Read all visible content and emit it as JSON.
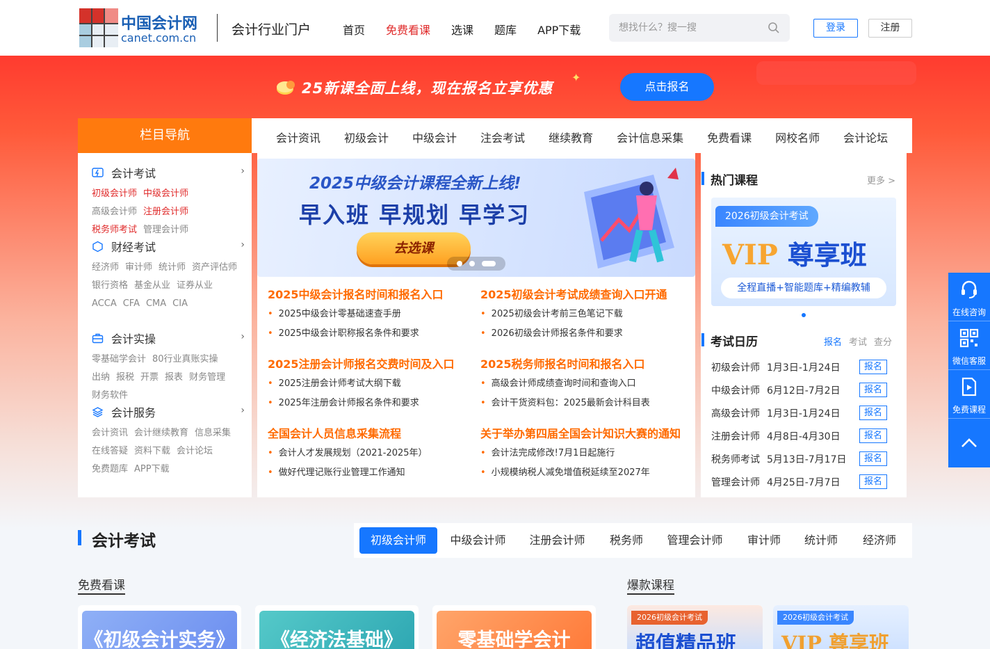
{
  "header": {
    "logo_cn": "中国会计网",
    "logo_en": "canet.com.cn",
    "portal": "会计行业门户",
    "nav": [
      "首页",
      "免费看课",
      "选课",
      "题库",
      "APP下载"
    ],
    "search_placeholder": "想找什么？搜一搜",
    "login": "登录",
    "register": "注册"
  },
  "promo": {
    "text": "25新课全面上线，现在报名立享优惠",
    "button": "点击报名"
  },
  "channel": {
    "title": "栏目导航",
    "items": [
      "会计资讯",
      "初级会计",
      "中级会计",
      "注会考试",
      "继续教育",
      "会计信息采集",
      "免费看课",
      "网校名师",
      "会计论坛"
    ]
  },
  "categories": [
    {
      "title": "会计考试",
      "icon": "lightning-icon",
      "links": [
        {
          "t": "初级会计师",
          "hot": true
        },
        {
          "t": "中级会计师",
          "hot": true
        },
        {
          "t": "高级会计师",
          "hot": false
        },
        {
          "t": "注册会计师",
          "hot": true
        },
        {
          "t": "税务师考试",
          "hot": true
        },
        {
          "t": "管理会计师",
          "hot": false
        }
      ]
    },
    {
      "title": "财经考试",
      "icon": "hexagon-icon",
      "links": [
        {
          "t": "经济师",
          "hot": false
        },
        {
          "t": "审计师",
          "hot": false
        },
        {
          "t": "统计师",
          "hot": false
        },
        {
          "t": "资产评估师",
          "hot": false
        },
        {
          "t": "银行资格",
          "hot": false
        },
        {
          "t": "基金从业",
          "hot": false
        },
        {
          "t": "证券从业",
          "hot": false
        },
        {
          "t": "ACCA",
          "hot": false
        },
        {
          "t": "CFA",
          "hot": false
        },
        {
          "t": "CMA",
          "hot": false
        },
        {
          "t": "CIA",
          "hot": false
        }
      ]
    },
    {
      "title": "会计实操",
      "icon": "briefcase-icon",
      "links": [
        {
          "t": "零基础学会计",
          "hot": false
        },
        {
          "t": "80行业真账实操",
          "hot": false
        },
        {
          "t": "出纳",
          "hot": false
        },
        {
          "t": "报税",
          "hot": false
        },
        {
          "t": "开票",
          "hot": false
        },
        {
          "t": "报表",
          "hot": false
        },
        {
          "t": "财务管理",
          "hot": false
        },
        {
          "t": "财务软件",
          "hot": false
        }
      ]
    },
    {
      "title": "会计服务",
      "icon": "layers-icon",
      "links": [
        {
          "t": "会计资讯",
          "hot": false
        },
        {
          "t": "会计继续教育",
          "hot": false
        },
        {
          "t": "信息采集",
          "hot": false
        },
        {
          "t": "在线答疑",
          "hot": false
        },
        {
          "t": "资料下载",
          "hot": false
        },
        {
          "t": "会计论坛",
          "hot": false
        },
        {
          "t": "免费题库",
          "hot": false
        },
        {
          "t": "APP下载",
          "hot": false
        }
      ]
    }
  ],
  "slide": {
    "title": "2025中级会计课程全新上线!",
    "big": "早入班 早规划 早学习",
    "button": "去选课"
  },
  "news": {
    "left": [
      {
        "h": "2025中级会计报名时间和报名入口",
        "items": [
          "2025中级会计零基础速查手册",
          "2025中级会计职称报名条件和要求"
        ]
      },
      {
        "h": "2025注册会计师报名交费时间及入口",
        "items": [
          "2025注册会计师考试大纲下载",
          "2025年注册会计师报名条件和要求"
        ]
      },
      {
        "h": "全国会计人员信息采集流程",
        "items": [
          "会计人才发展规划（2021-2025年）",
          "做好代理记账行业管理工作通知"
        ]
      }
    ],
    "right": [
      {
        "h": "2025初级会计考试成绩查询入口开通",
        "items": [
          "2025初级会计考前三色笔记下载",
          "2026初级会计师报名条件和要求"
        ]
      },
      {
        "h": "2025税务师报名时间和报名入口",
        "items": [
          "高级会计师成绩查询时间和查询入口",
          "会计干货资料包：2025最新会计科目表"
        ]
      },
      {
        "h": "关于举办第四届全国会计知识大赛的通知",
        "items": [
          "会计法完成修改!7月1日起施行",
          "小规模纳税人减免增值税延续至2027年"
        ]
      }
    ]
  },
  "hot": {
    "title": "热门课程",
    "more": "更多 >",
    "tag": "2026初级会计考试",
    "vip_a": "VIP",
    "vip_b": "尊享班",
    "sub": "全程直播+智能题库+精编教辅"
  },
  "calendar": {
    "title": "考试日历",
    "tabs": [
      "报名",
      "考试",
      "查分"
    ],
    "button": "报名",
    "rows": [
      {
        "name": "初级会计师",
        "date": "1月3日-1月24日"
      },
      {
        "name": "中级会计师",
        "date": "6月12日-7月2日"
      },
      {
        "name": "高级会计师",
        "date": "1月3日-1月24日"
      },
      {
        "name": "注册会计师",
        "date": "4月8日-4月30日"
      },
      {
        "name": "税务师考试",
        "date": "5月13日-7月17日"
      },
      {
        "name": "管理会计师",
        "date": "4月25日-7月7日"
      }
    ]
  },
  "float": [
    "在线咨询",
    "微信客服",
    "免费课程"
  ],
  "exam": {
    "title": "会计考试",
    "tabs": [
      "初级会计师",
      "中级会计师",
      "注册会计师",
      "税务师",
      "管理会计师",
      "审计师",
      "统计师",
      "经济师"
    ],
    "free_head": "免费看课",
    "hot_head": "爆款课程",
    "free_cards": [
      "《初级会计实务》",
      "《经济法基础》",
      "零基础学会计"
    ],
    "prod_cards": [
      {
        "tag": "2026初级会计考试",
        "big": "超值精品班"
      },
      {
        "tag": "2026初级会计考试",
        "big": "VIP 尊享班"
      }
    ]
  }
}
